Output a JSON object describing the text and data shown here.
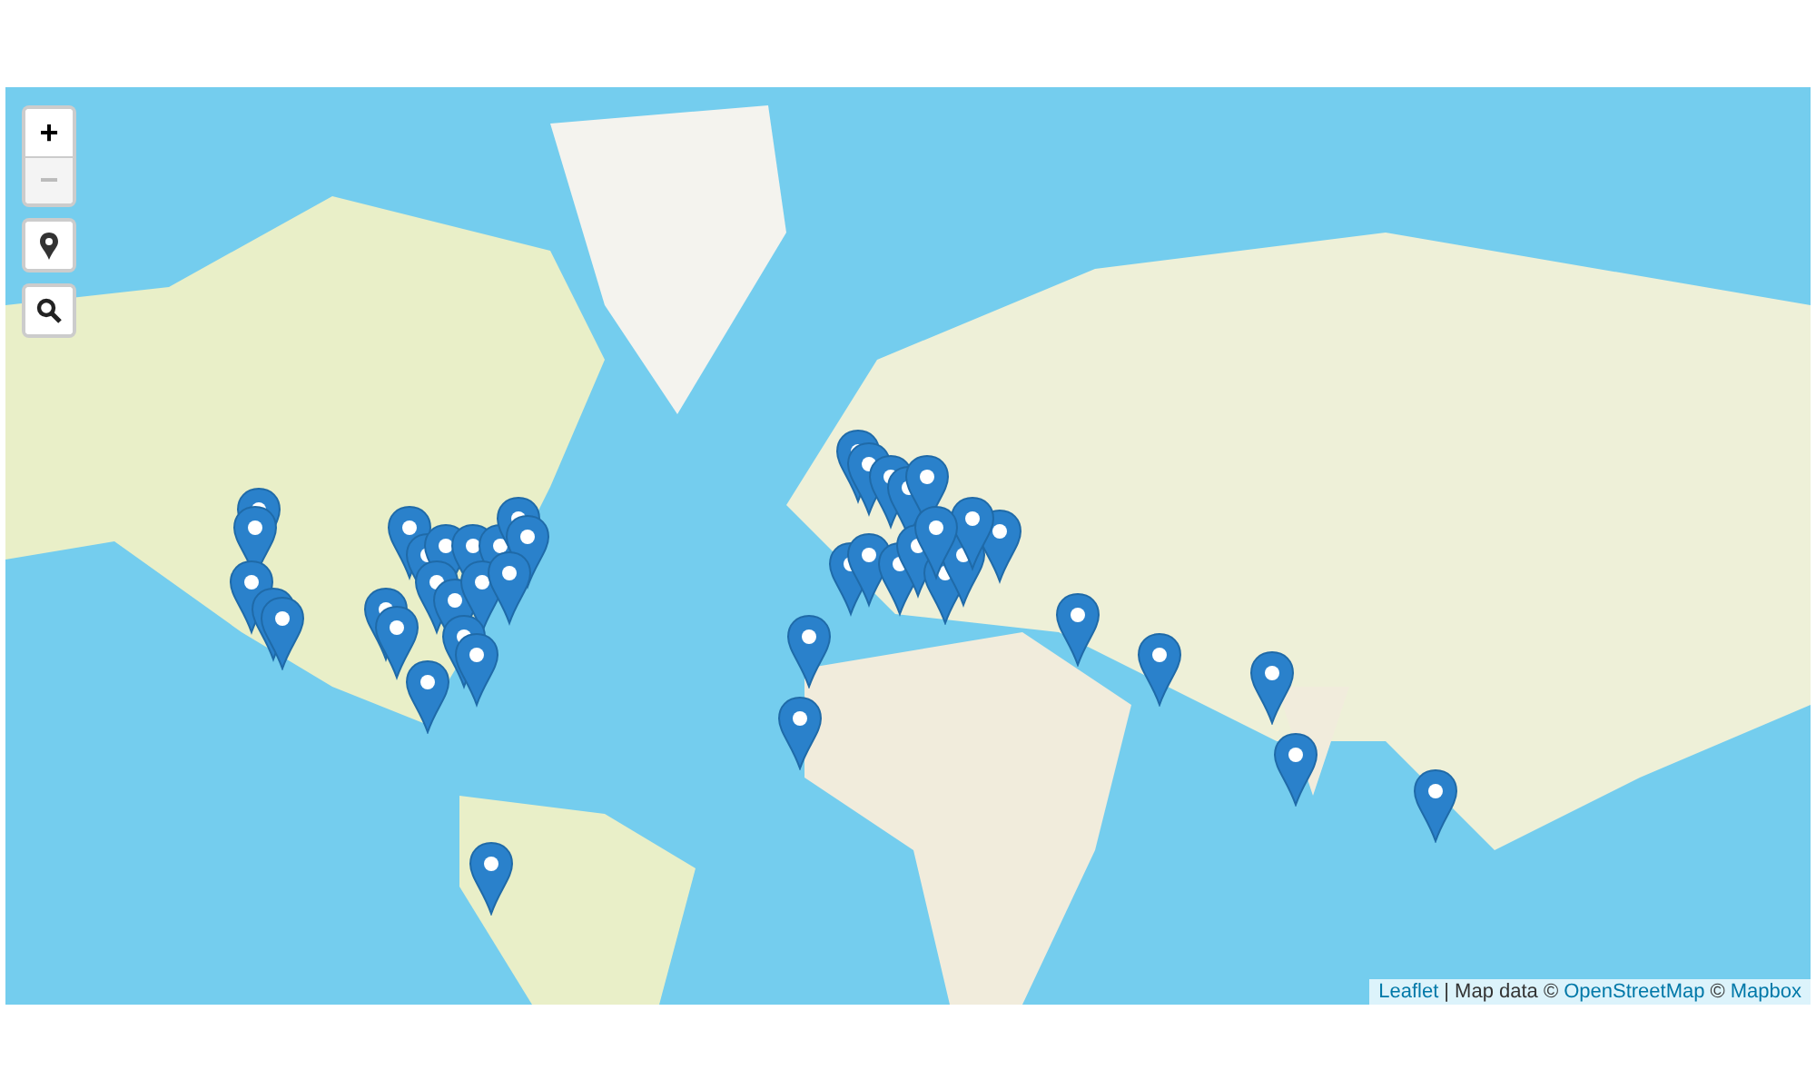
{
  "zoom_controls": [
    {
      "label": "+",
      "disabled": false
    },
    {
      "label": "−",
      "disabled": true
    }
  ],
  "tool_buttons": [
    {
      "kind": "locate"
    },
    {
      "kind": "search"
    }
  ],
  "attribution": [
    {
      "kind": "link",
      "text": "Leaflet"
    },
    {
      "kind": "text",
      "text": "| Map data ©"
    },
    {
      "kind": "link",
      "text": "OpenStreetMap"
    },
    {
      "kind": "text",
      "text": "©"
    },
    {
      "kind": "link",
      "text": "Mapbox"
    }
  ]
}
